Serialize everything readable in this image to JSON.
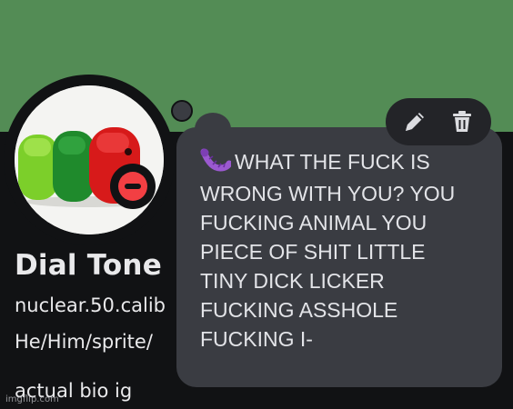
{
  "profile": {
    "display_name": "Dial Tone",
    "username": "nuclear.50.calib",
    "pronouns": "He/Him/sprite/",
    "bio": "actual bio ig",
    "status": "do-not-disturb"
  },
  "custom_status": {
    "emoji": "worm-icon",
    "lines": [
      "WHAT THE FUCK IS",
      "WRONG WITH YOU? YOU",
      "FUCKING ANIMAL YOU",
      "PIECE OF SHIT LITTLE",
      "TINY DICK LICKER",
      "FUCKING ASSHOLE",
      "FUCKING I-"
    ]
  },
  "toolbar": {
    "edit_icon": "pencil-icon",
    "delete_icon": "trash-icon"
  },
  "watermark": "imgflip.com",
  "colors": {
    "banner": "#538c55",
    "background": "#111214",
    "bubble": "#3a3c42",
    "dnd": "#f23f43",
    "toolbar": "#232428"
  }
}
